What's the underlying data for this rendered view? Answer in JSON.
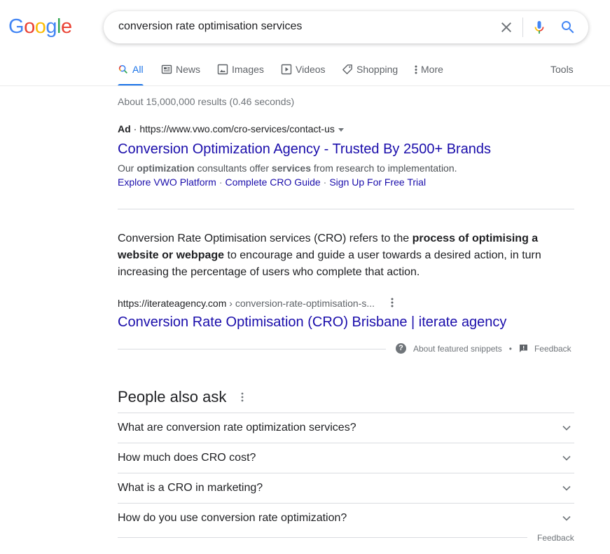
{
  "logo": {
    "letters": [
      {
        "char": "G",
        "color": "#4285f4"
      },
      {
        "char": "o",
        "color": "#ea4335"
      },
      {
        "char": "o",
        "color": "#fbbc05"
      },
      {
        "char": "g",
        "color": "#4285f4"
      },
      {
        "char": "l",
        "color": "#34a853"
      },
      {
        "char": "e",
        "color": "#ea4335"
      }
    ]
  },
  "search": {
    "query": "conversion rate optimisation services",
    "clear_icon": "close-icon",
    "mic_icon": "microphone-icon",
    "search_icon": "search-icon"
  },
  "tabs": {
    "items": [
      {
        "label": "All",
        "icon": "search-icon",
        "active": true
      },
      {
        "label": "News",
        "icon": "newspaper-icon",
        "active": false
      },
      {
        "label": "Images",
        "icon": "image-icon",
        "active": false
      },
      {
        "label": "Videos",
        "icon": "play-icon",
        "active": false
      },
      {
        "label": "Shopping",
        "icon": "tag-icon",
        "active": false
      },
      {
        "label": "More",
        "icon": "more-vert-icon",
        "active": false
      }
    ],
    "tools": "Tools"
  },
  "stats": "About 15,000,000 results (0.46 seconds)",
  "ad": {
    "badge": "Ad",
    "dot": "·",
    "url": "https://www.vwo.com/cro-services/contact-us",
    "title": "Conversion Optimization Agency - Trusted By 2500+ Brands",
    "desc": {
      "p1": "Our ",
      "b1": "optimization",
      "p2": " consultants offer ",
      "b2": "services",
      "p3": " from research to implementation."
    },
    "sitelinks": [
      "Explore VWO Platform",
      "Complete CRO Guide",
      "Sign Up For Free Trial"
    ],
    "sitelink_sep": "·"
  },
  "featured_snippet": {
    "text_1": "Conversion Rate Optimisation services (CRO) refers to the ",
    "bold_1": "process of optimising a website or webpage",
    "text_2": " to encourage and guide a user towards a desired action, in turn increasing the percentage of users who complete that action.",
    "cite_domain": "https://iterateagency.com",
    "cite_path": " › conversion-rate-optimisation-s...",
    "title": "Conversion Rate Optimisation (CRO) Brisbane | iterate agency",
    "about_label": "About featured snippets",
    "bullet": "•",
    "feedback_label": "Feedback"
  },
  "people_also_ask": {
    "title": "People also ask",
    "questions": [
      "What are conversion rate optimization services?",
      "How much does CRO cost?",
      "What is a CRO in marketing?",
      "How do you use conversion rate optimization?"
    ],
    "feedback_label": "Feedback"
  }
}
